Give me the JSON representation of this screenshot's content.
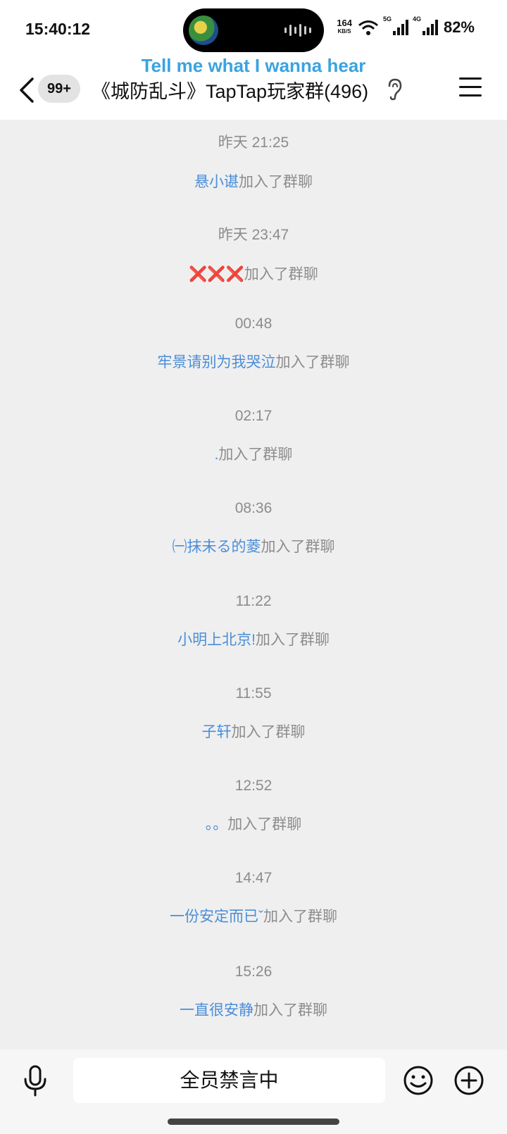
{
  "status_bar": {
    "time": "15:40:12",
    "net_speed": "164",
    "net_speed_unit": "KB/S",
    "signal1_label": "5G",
    "signal2_label": "4G",
    "battery": "82%"
  },
  "header": {
    "now_playing": "Tell me what I wanna hear",
    "unread_badge": "99+",
    "group_title": "《城防乱斗》TapTap玩家群(496)"
  },
  "messages": [
    {
      "time": "昨天 21:25",
      "nick": "悬小谌",
      "action": "加入了群聊"
    },
    {
      "time": "昨天 23:47",
      "nick": "❌❌❌",
      "action": "加入了群聊"
    },
    {
      "time": "00:48",
      "nick": "牢景请别为我哭泣",
      "action": "加入了群聊"
    },
    {
      "time": "02:17",
      "nick": ".",
      "action": "加入了群聊"
    },
    {
      "time": "08:36",
      "nick": "㈠抹未る的菱",
      "action": "加入了群聊"
    },
    {
      "time": "11:22",
      "nick": "小明上北京!",
      "action": "加入了群聊"
    },
    {
      "time": "11:55",
      "nick": "子轩",
      "action": "加入了群聊"
    },
    {
      "time": "12:52",
      "nick": "。。",
      "action": "加入了群聊"
    },
    {
      "time": "14:47",
      "nick": "一份安定而已ˇ",
      "action": "加入了群聊"
    },
    {
      "time": "15:26",
      "nick": "一直很安静",
      "action": "加入了群聊"
    }
  ],
  "input_bar": {
    "muted_text": "全员禁言中",
    "mic_icon": "microphone-icon",
    "emoji_icon": "smiley-icon",
    "plus_icon": "plus-circle-icon"
  },
  "colors": {
    "nick_blue": "#4a8ed8",
    "system_gray": "#8c8c8c",
    "song_blue": "#3aa3e0"
  }
}
